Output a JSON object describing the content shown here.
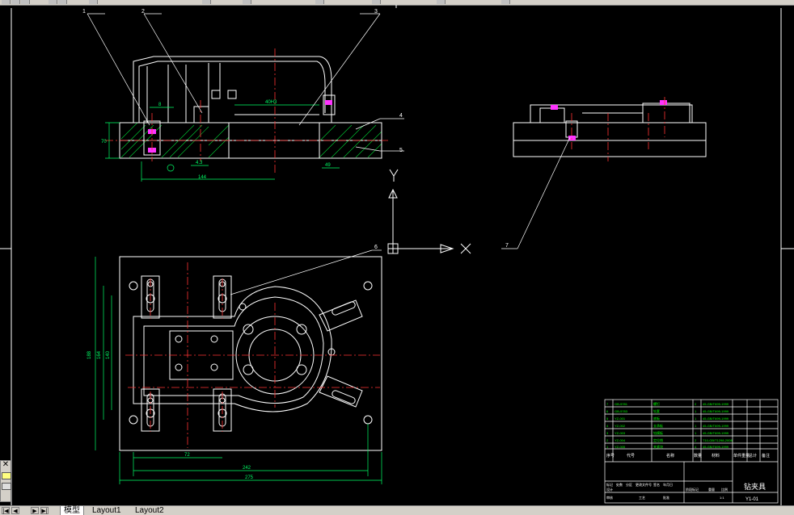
{
  "layout_tabs": [
    {
      "label": "模型",
      "active": true
    },
    {
      "label": "Layout1",
      "active": false
    },
    {
      "label": "Layout2",
      "active": false
    }
  ],
  "nav_buttons": [
    "first-tab",
    "prev-tab",
    "next-tab",
    "last-tab"
  ],
  "ucs": {
    "x_label": "X",
    "y_label": "Y"
  },
  "balloons": [
    "1",
    "2",
    "3",
    "4",
    "5",
    "6",
    "7"
  ],
  "dimensions": {
    "top_width": "144",
    "top_height": "70",
    "top_small": "8",
    "top_mid": "40H3",
    "top_right_small": "49",
    "top_left": "4.3",
    "plan_width_inner": "242",
    "plan_width_outer": "275",
    "plan_left_offset": "72",
    "plan_height_outer": "188",
    "plan_height_mid": "164",
    "plan_height_inner": "140"
  },
  "title_block": {
    "drawing_title": "钻夹具",
    "drawing_number": "Y1-01",
    "header_cols": [
      "序号",
      "代号",
      "名称",
      "数量",
      "材料",
      "单件重量",
      "总计",
      "备注"
    ],
    "rows": [
      [
        "7",
        "GB-5781",
        "螺钉",
        "2",
        "45-GB/T699-1999"
      ],
      [
        "6",
        "GB-5783",
        "钻套",
        "1",
        "45-GB/T699-1999"
      ],
      [
        "5",
        "YZ-001",
        "底板",
        "1",
        "45-GB/T699-1999"
      ],
      [
        "4",
        "YZ-002",
        "支承板",
        "1",
        "45-GB/T699-1999"
      ],
      [
        "3",
        "YZ-003",
        "钻模板",
        "1",
        "45-GB/T699-1999"
      ],
      [
        "2",
        "YZ-004",
        "定位销",
        "2",
        "T10-GB/T1298-2008"
      ],
      [
        "1",
        "YZ-005",
        "夹紧块",
        "4",
        "45-GB/T699-1999"
      ]
    ],
    "sign_labels": [
      "标记",
      "处数",
      "分区",
      "更改文件号",
      "签名",
      "年月日"
    ],
    "lower_labels": [
      "设计",
      "审核",
      "工艺",
      "批准"
    ],
    "stage_labels": [
      "阶段标记",
      "重量",
      "比例"
    ],
    "scale": "1:1"
  },
  "colors": {
    "background": "#000000",
    "outline": "#ffffff",
    "center": "#ff3333",
    "dimension": "#00ff66",
    "hatch": "#00cc33",
    "bolt": "#ff33ff",
    "title": "#00ff00"
  }
}
